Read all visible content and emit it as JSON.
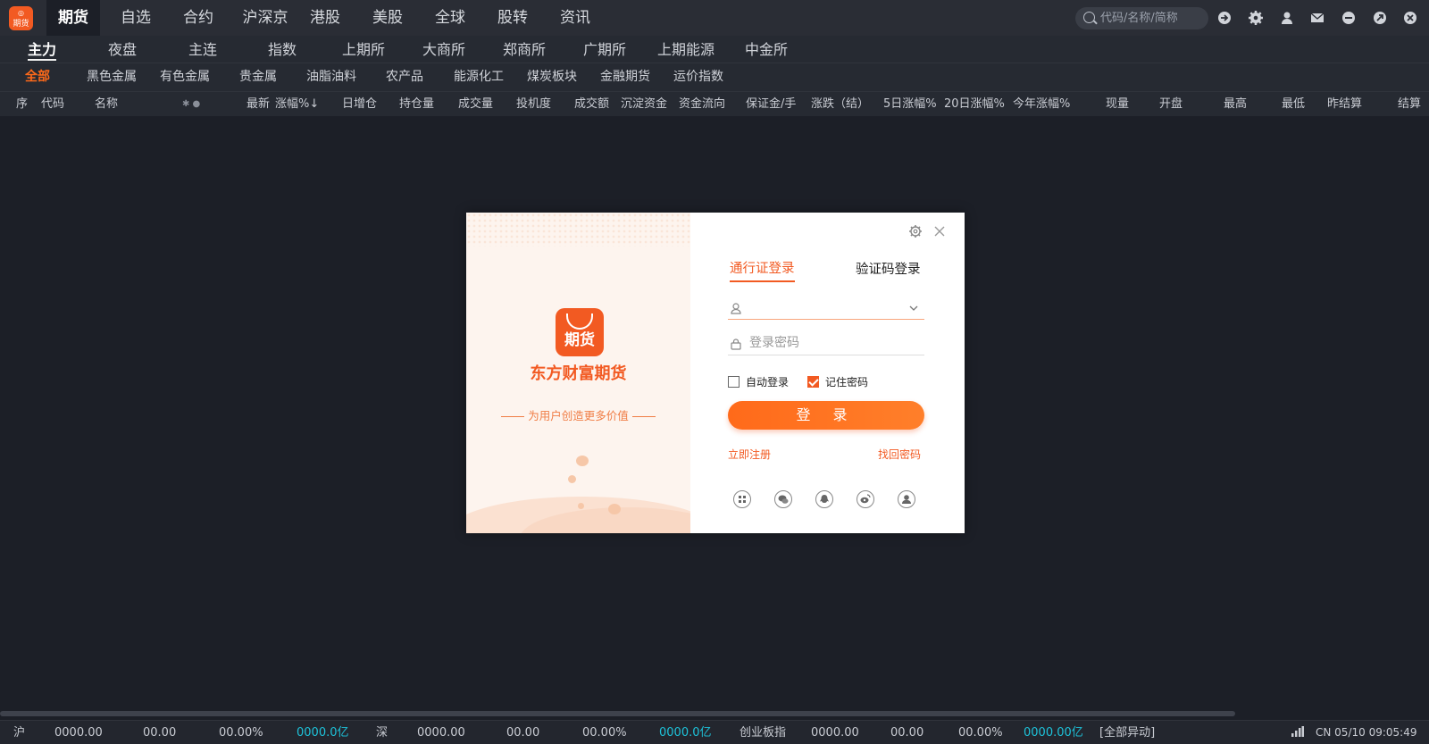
{
  "topnav": {
    "logo_text": "期货",
    "tabs": [
      "期货",
      "自选",
      "合约",
      "沪深京",
      "港股",
      "美股",
      "全球",
      "股转",
      "资讯"
    ],
    "search_placeholder": "代码/名称/简称",
    "icons": [
      "refresh-icon",
      "settings-icon",
      "user-icon",
      "mail-icon",
      "minimize-icon",
      "restore-icon",
      "close-icon"
    ]
  },
  "subnav": {
    "tabs": [
      "主力",
      "夜盘",
      "主连",
      "指数",
      "上期所",
      "大商所",
      "郑商所",
      "广期所",
      "上期能源",
      "中金所"
    ]
  },
  "catnav": {
    "tabs": [
      "全部",
      "黑色金属",
      "有色金属",
      "贵金属",
      "油脂油料",
      "农产品",
      "能源化工",
      "煤炭板块",
      "金融期货",
      "运价指数"
    ]
  },
  "table": {
    "headers": [
      "序",
      "代码",
      "名称",
      "最新",
      "涨幅%↓",
      "日增仓",
      "持仓量",
      "成交量",
      "投机度",
      "成交额",
      "沉淀资金",
      "资金流向",
      "保证金/手",
      "涨跌（结）",
      "5日涨幅%",
      "20日涨幅%",
      "今年涨幅%",
      "现量",
      "开盘",
      "最高",
      "最低",
      "昨结算",
      "结算"
    ]
  },
  "status": {
    "sh_label": "沪",
    "sh_index": "0000.00",
    "sh_change": "00.00",
    "sh_pct": "00.00%",
    "sh_amount": "0000.0亿",
    "sz_label": "深",
    "sz_index": "0000.00",
    "sz_change": "00.00",
    "sz_pct": "00.00%",
    "sz_amount": "0000.0亿",
    "cy_label": "创业板指",
    "cy_index": "0000.00",
    "cy_change": "00.00",
    "cy_pct": "00.00%",
    "cy_amount": "0000.00亿",
    "alerts": "[全部异动]",
    "datetime": "CN 05/10 09:05:49"
  },
  "dialog": {
    "brand": "东方财富期货",
    "app_logo_text": "期货",
    "slogan": "为用户创造更多价值",
    "tab_account": "通行证登录",
    "tab_code": "验证码登录",
    "username_value": "",
    "password_placeholder": "登录密码",
    "auto_login": "自动登录",
    "remember_password": "记住密码",
    "login_button": "登 录",
    "register_link": "立即注册",
    "forgot_link": "找回密码",
    "social_icons": [
      "qr-code-icon",
      "wechat-icon",
      "qq-icon",
      "weibo-icon",
      "account-icon"
    ]
  },
  "colors": {
    "accent": "#f25a22",
    "cyan": "#1ec2d9",
    "background": "#1c1f27"
  }
}
